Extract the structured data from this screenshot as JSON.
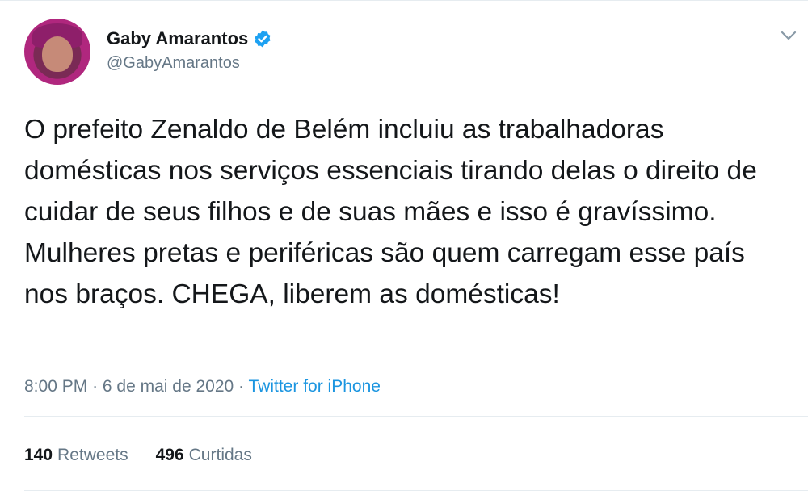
{
  "tweet": {
    "display_name": "Gaby Amarantos",
    "handle": "@GabyAmarantos",
    "verified": true,
    "text": "O prefeito Zenaldo de Belém incluiu as trabalhadoras domésticas nos serviços essenciais tirando delas o direito de cuidar de seus filhos e de suas mães e isso é gravíssimo. Mulheres pretas e periféricas são quem carregam esse país nos braços. CHEGA, liberem as domésticas!",
    "time": "8:00 PM",
    "date": "6 de mai de 2020",
    "separator": "·",
    "source": "Twitter for iPhone",
    "retweets_count": "140",
    "retweets_label": "Retweets",
    "likes_count": "496",
    "likes_label": "Curtidas"
  },
  "icons": {
    "verified": "verified-badge-icon",
    "caret": "chevron-down-icon"
  },
  "colors": {
    "text": "#14171a",
    "secondary": "#657786",
    "link": "#1b95e0",
    "verified": "#1da1f2",
    "divider": "#e6ecf0"
  }
}
